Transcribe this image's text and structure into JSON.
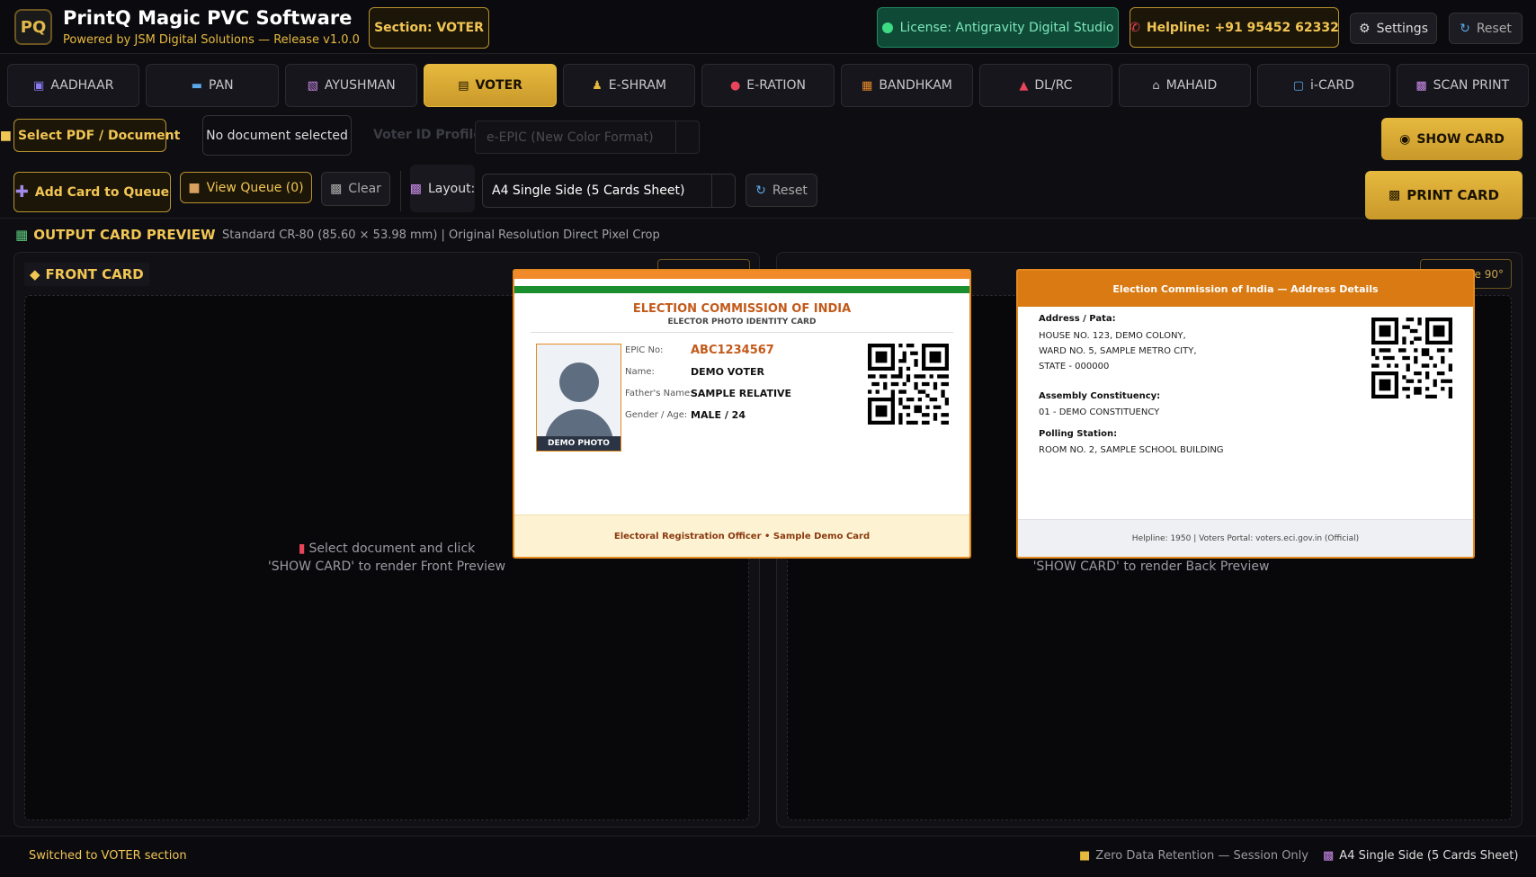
{
  "app": {
    "logo_text": "PQ",
    "title": "PrintQ Magic PVC Software",
    "subtitle": "Powered by JSM Digital Solutions — Release v1.0.0"
  },
  "header": {
    "section_badge": "Section: VOTER",
    "license": "License: Antigravity Digital Studio",
    "helpline": "Helpline: +91 95452 62332",
    "settings": "Settings",
    "reset": "Reset"
  },
  "tabs": [
    {
      "label": "AADHAAR",
      "icon": "id-icon"
    },
    {
      "label": "PAN",
      "icon": "card-icon"
    },
    {
      "label": "AYUSHMAN",
      "icon": "health-icon"
    },
    {
      "label": "VOTER",
      "icon": "ballot-icon",
      "active": true
    },
    {
      "label": "E-SHRAM",
      "icon": "worker-icon"
    },
    {
      "label": "E-RATION",
      "icon": "ration-icon"
    },
    {
      "label": "BANDHKAM",
      "icon": "construction-icon"
    },
    {
      "label": "DL/RC",
      "icon": "car-icon"
    },
    {
      "label": "MAHAID",
      "icon": "building-icon"
    },
    {
      "label": "i-CARD",
      "icon": "idcard-icon"
    },
    {
      "label": "SCAN  PRINT",
      "icon": "printer-icon"
    }
  ],
  "toolbar": {
    "select_pdf": "Select PDF / Document",
    "no_document": "No document selected",
    "voter_profile_label": "Voter ID Profile:",
    "voter_profile_value": "e-EPIC (New Color Format)",
    "show_card": "SHOW CARD",
    "add_queue": "Add Card to Queue",
    "view_queue": "View Queue (0)",
    "clear": "Clear",
    "layout_label": "Layout:",
    "layout_value": "A4 Single Side (5 Cards Sheet)",
    "reset": "Reset",
    "print_card": "PRINT CARD"
  },
  "output": {
    "title": "OUTPUT CARD PREVIEW",
    "subtitle": "Standard CR-80 (85.60 × 53.98 mm) | Original Resolution Direct Pixel Crop",
    "front_label": "FRONT CARD",
    "rotate_label": "e 90°",
    "front_hint_1": "Select document and click",
    "front_hint_2": "'SHOW CARD' to render Front Preview",
    "back_hint": "'SHOW CARD' to render Back Preview"
  },
  "front_card": {
    "title": "ELECTION COMMISSION OF INDIA",
    "subtitle": "ELECTOR PHOTO IDENTITY CARD",
    "photo_caption": "DEMO PHOTO",
    "fields": [
      {
        "label": "EPIC No:",
        "value": "ABC1234567"
      },
      {
        "label": "Name:",
        "value": "DEMO VOTER"
      },
      {
        "label": "Father's Name:",
        "value": "SAMPLE RELATIVE"
      },
      {
        "label": "Gender / Age:",
        "value": "MALE / 24"
      }
    ],
    "footer": "Electoral Registration Officer • Sample Demo Card"
  },
  "back_card": {
    "header": "Election Commission of India — Address Details",
    "address_label": "Address / Pata:",
    "address_lines": [
      "HOUSE NO. 123, DEMO COLONY,",
      "WARD NO. 5, SAMPLE METRO CITY,",
      "STATE - 000000"
    ],
    "constituency_label": "Assembly Constituency:",
    "constituency_value": "01 - DEMO CONSTITUENCY",
    "polling_label": "Polling Station:",
    "polling_value": "ROOM NO. 2, SAMPLE SCHOOL BUILDING",
    "footer": "Helpline: 1950 | Voters Portal: voters.eci.gov.in (Official)"
  },
  "status": {
    "left": "Switched to VOTER section",
    "retention": "Zero Data Retention — Session Only",
    "layout": "A4 Single Side (5 Cards Sheet)"
  },
  "colors": {
    "accent": "#e6b93e",
    "license_bg": "#0f4a37",
    "card_orange": "#d97a12"
  }
}
